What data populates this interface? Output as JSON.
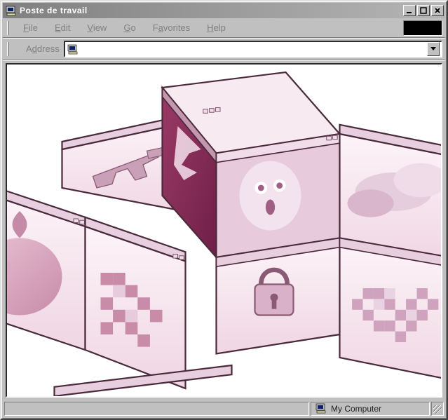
{
  "window": {
    "title": "Poste de travail"
  },
  "menu": {
    "file": "File",
    "edit": "Edit",
    "view": "View",
    "go": "Go",
    "favorites": "Favorites",
    "help": "Help"
  },
  "addressbar": {
    "label": "Address",
    "value": ""
  },
  "statusbar": {
    "location": "My Computer"
  },
  "icons": {
    "computer": "computer-icon",
    "minimize": "minimize-icon",
    "maximize": "maximize-icon",
    "close": "close-icon",
    "dropdown": "chevron-down-icon"
  }
}
